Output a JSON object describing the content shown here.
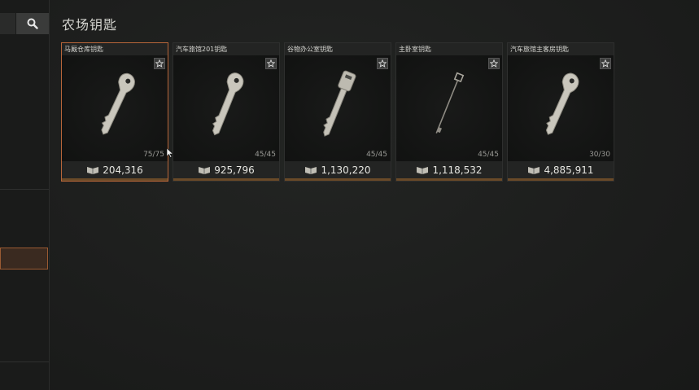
{
  "page": {
    "title": "农场钥匙"
  },
  "sidebar": {
    "search_icon": "search-icon"
  },
  "items": [
    {
      "name": "马厩仓库钥匙",
      "count": "75/75",
      "price": "204,316",
      "icon": "key-icon",
      "selected": true
    },
    {
      "name": "汽车旅馆201钥匙",
      "count": "45/45",
      "price": "925,796",
      "icon": "key-icon",
      "selected": false
    },
    {
      "name": "谷物办公室钥匙",
      "count": "45/45",
      "price": "1,130,220",
      "icon": "keycard-key-icon",
      "selected": false
    },
    {
      "name": "主卧室钥匙",
      "count": "45/45",
      "price": "1,118,532",
      "icon": "skeleton-key-icon",
      "selected": false
    },
    {
      "name": "汽车旅馆主客房钥匙",
      "count": "30/30",
      "price": "4,885,911",
      "icon": "key-icon",
      "selected": false
    }
  ],
  "colors": {
    "accent": "#b8663a",
    "background": "#1c1d1c"
  }
}
